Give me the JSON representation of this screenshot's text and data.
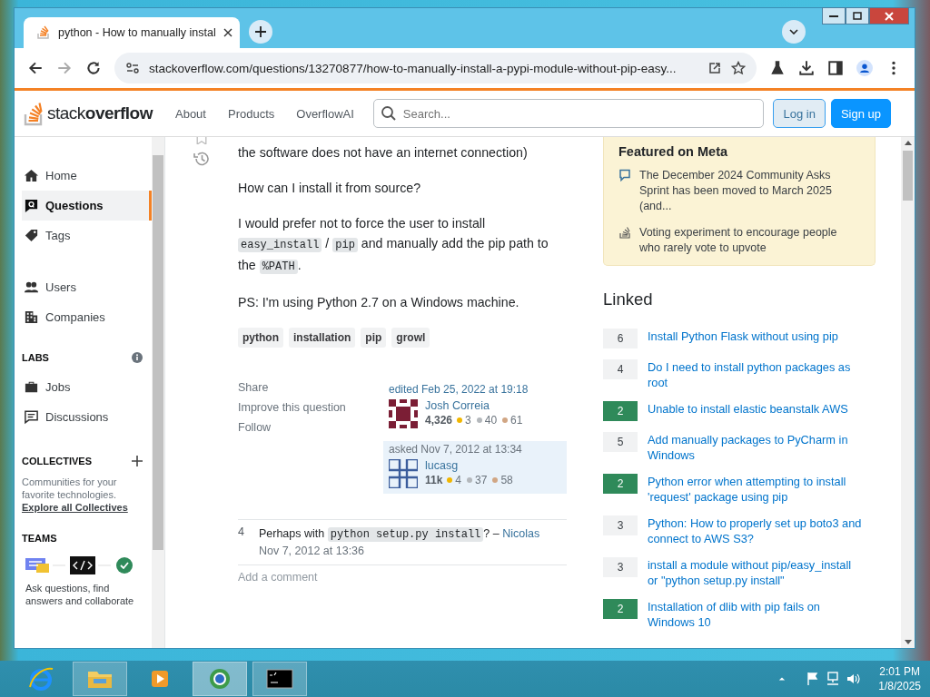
{
  "browser": {
    "tab_title": "python - How to manually instal",
    "url": "stackoverflow.com/questions/13270877/how-to-manually-install-a-pypi-module-without-pip-easy..."
  },
  "header": {
    "logo_prefix": "stack",
    "logo_suffix": "overflow",
    "nav": [
      "About",
      "Products",
      "OverflowAI"
    ],
    "search": {
      "placeholder": "Search..."
    },
    "login": "Log in",
    "signup": "Sign up"
  },
  "sidebar": {
    "items": [
      {
        "label": "Home",
        "selected": false
      },
      {
        "label": "Questions",
        "selected": true
      },
      {
        "label": "Tags",
        "selected": false
      },
      {
        "label": "Users",
        "selected": false
      },
      {
        "label": "Companies",
        "selected": false
      }
    ],
    "labs_title": "LABS",
    "labs_items": [
      {
        "label": "Jobs",
        "selected": false
      },
      {
        "label": "Discussions",
        "selected": false
      }
    ],
    "collectives": {
      "title": "COLLECTIVES",
      "text": "Communities for your favorite technologies.",
      "link": "Explore all Collectives"
    },
    "teams": {
      "title": "TEAMS",
      "text": "Ask questions, find answers and collaborate"
    }
  },
  "question": {
    "paragraphs": [
      [
        {
          "kind": "text",
          "text": "the software does not have an internet connection)"
        }
      ],
      [
        {
          "kind": "text",
          "text": "How can I install it from source?"
        }
      ],
      [
        {
          "kind": "text",
          "text": "I would prefer not to force the user to install "
        },
        {
          "kind": "code",
          "text": "easy_install"
        },
        {
          "kind": "text",
          "text": " / "
        },
        {
          "kind": "code",
          "text": "pip"
        },
        {
          "kind": "text",
          "text": " and manually add the pip path to the "
        },
        {
          "kind": "code",
          "text": "%PATH"
        },
        {
          "kind": "text",
          "text": "."
        }
      ],
      [
        {
          "kind": "text",
          "text": "PS: I'm using Python 2.7 on a Windows machine."
        }
      ]
    ],
    "tags": [
      "python",
      "installation",
      "pip",
      "growl"
    ],
    "menu": [
      "Share",
      "Improve this question",
      "Follow"
    ],
    "edited": {
      "action": "edited Feb 25, 2022 at 19:18",
      "user": "Josh Correia",
      "reputation": "4,326",
      "badges": [
        {
          "count": "3",
          "color": "#f1b600"
        },
        {
          "count": "40",
          "color": "#b4b8bc"
        },
        {
          "count": "61",
          "color": "#d1a684"
        }
      ]
    },
    "asked": {
      "action": "asked Nov 7, 2012 at 13:34",
      "user": "lucasg",
      "reputation": "11k",
      "badges": [
        {
          "count": "4",
          "color": "#f1b600"
        },
        {
          "count": "37",
          "color": "#b4b8bc"
        },
        {
          "count": "58",
          "color": "#d1a684"
        }
      ]
    },
    "comment": {
      "score": "4",
      "segments": [
        {
          "kind": "text",
          "text": "Perhaps with "
        },
        {
          "kind": "code",
          "text": "python setup.py install"
        },
        {
          "kind": "text",
          "text": "? – "
        }
      ],
      "author": "Nicolas",
      "date": "Nov 7, 2012 at 13:36"
    },
    "add_comment": "Add a comment"
  },
  "featured": {
    "title": "Featured on Meta",
    "items": [
      {
        "text": "The December 2024 Community Asks Sprint has been moved to March 2025 (and..."
      },
      {
        "text": "Voting experiment to encourage people who rarely vote to upvote"
      }
    ]
  },
  "linked": {
    "title": "Linked",
    "items": [
      {
        "score": "6",
        "title": "Install Python Flask without using pip",
        "answered": false
      },
      {
        "score": "4",
        "title": "Do I need to install python packages as root",
        "answered": false
      },
      {
        "score": "2",
        "title": "Unable to install elastic beanstalk AWS",
        "answered": true
      },
      {
        "score": "5",
        "title": "Add manually packages to PyCharm in Windows",
        "answered": false
      },
      {
        "score": "2",
        "title": "Python error when attempting to install 'request' package using pip",
        "answered": true
      },
      {
        "score": "3",
        "title": "Python: How to properly set up boto3 and connect to AWS S3?",
        "answered": false
      },
      {
        "score": "3",
        "title": "install a module without pip/easy_install or \"python setup.py install\"",
        "answered": false
      },
      {
        "score": "2",
        "title": "Installation of dlib with pip fails on Windows 10",
        "answered": true
      }
    ]
  },
  "taskbar": {
    "time": "2:01 PM",
    "date": "1/8/2025"
  }
}
